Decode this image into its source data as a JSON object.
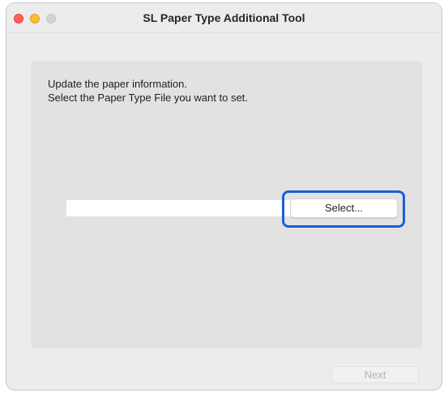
{
  "window": {
    "title": "SL Paper Type Additional Tool"
  },
  "instructions": {
    "line1": "Update the paper information.",
    "line2": "Select the Paper Type File you want to set."
  },
  "file_field": {
    "value": ""
  },
  "buttons": {
    "select_label": "Select...",
    "next_label": "Next",
    "next_enabled": false
  },
  "colors": {
    "highlight": "#1a5fd6",
    "close": "#fe5f57",
    "minimize": "#febc2e",
    "zoom_inactive": "#d3d3d3",
    "panel": "#e2e2e2",
    "window_bg": "#ececec"
  },
  "icons": [
    "close-window-icon",
    "minimize-window-icon",
    "zoom-window-icon"
  ]
}
